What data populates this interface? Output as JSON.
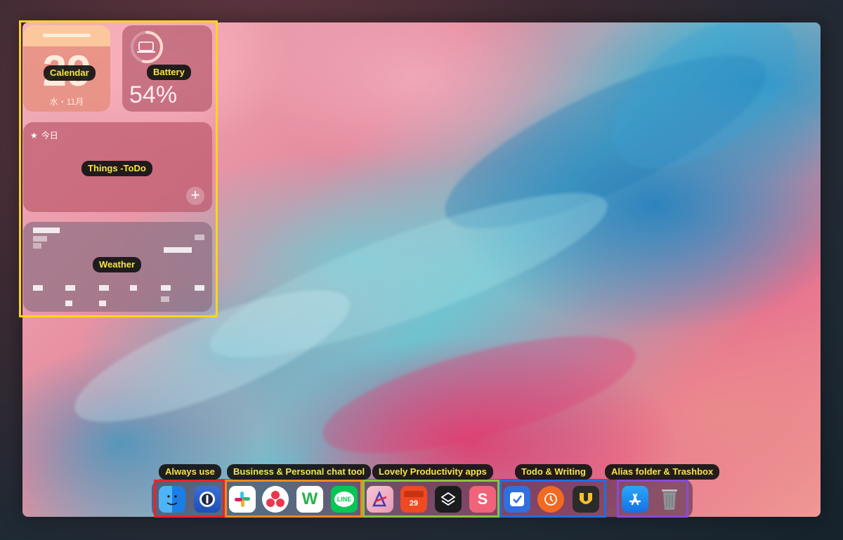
{
  "widgets": {
    "calendar": {
      "day": "29",
      "subtitle": "水・11月",
      "label": "Calendar"
    },
    "battery": {
      "percent": "54%",
      "level": 0.54,
      "label": "Battery"
    },
    "things": {
      "header": "今日",
      "label": "Things -ToDo",
      "add": "+"
    },
    "weather": {
      "label": "Weather"
    }
  },
  "dock_groups": [
    {
      "label": "Always use",
      "color": "#e8232f",
      "apps": [
        "finder-icon",
        "1password-icon"
      ]
    },
    {
      "label": "Business & Personal chat tool",
      "color": "#f08a1c",
      "apps": [
        "slack-icon",
        "asana-icon",
        "works-icon",
        "line-icon"
      ]
    },
    {
      "label": "Lovely Productivity apps",
      "color": "#8ac33d",
      "apps": [
        "affinity-icon",
        "fantastical-icon",
        "layers-icon",
        "scrivener-icon"
      ]
    },
    {
      "label": "Todo & Writing",
      "color": "#1e6fe0",
      "apps": [
        "things-icon",
        "focus-icon",
        "ulysses-icon"
      ]
    },
    {
      "label": "Alias folder & Trashbox",
      "color": "#8a4ad6",
      "apps": [
        "app-store-icon",
        "trash-icon"
      ]
    }
  ],
  "icons": {
    "line_text": "LINE",
    "calendar_app_day": "29",
    "scrivener_text": "S"
  },
  "colors": {
    "widgets_frame": "#ffd51a",
    "chip_text": "#f5e642"
  }
}
